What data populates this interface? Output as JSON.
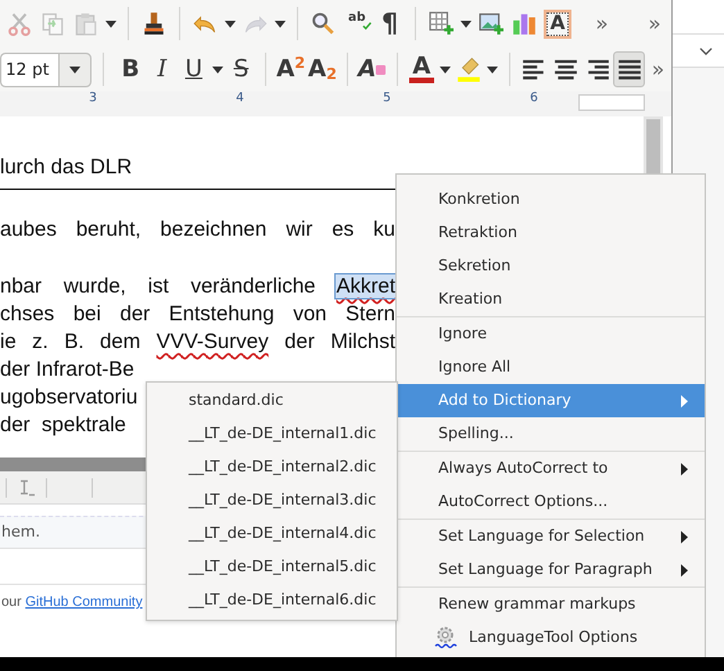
{
  "toolbar_1": [
    {
      "kind": "cut",
      "disabled": true
    },
    {
      "kind": "copy",
      "disabled": true
    },
    {
      "kind": "paste",
      "disabled": true,
      "dropdown": true
    },
    {
      "kind": "separator"
    },
    {
      "kind": "clone",
      "disabled": false
    },
    {
      "kind": "separator"
    },
    {
      "kind": "undo",
      "disabled": false,
      "dropdown": true
    },
    {
      "kind": "redo",
      "disabled": true,
      "dropdown": true
    },
    {
      "kind": "separator"
    },
    {
      "kind": "find",
      "disabled": false
    },
    {
      "kind": "spelling",
      "label": "ab",
      "disabled": false
    },
    {
      "kind": "formatting-marks",
      "label": "¶",
      "disabled": false
    },
    {
      "kind": "separator"
    },
    {
      "kind": "table",
      "disabled": false,
      "dropdown": true
    },
    {
      "kind": "image",
      "disabled": false
    },
    {
      "kind": "chart",
      "disabled": false
    },
    {
      "kind": "text-box",
      "label": "A",
      "disabled": false
    },
    {
      "kind": "spacer"
    },
    {
      "kind": "overflow",
      "label": "»",
      "disabled": false
    },
    {
      "kind": "overflow",
      "label": "»",
      "disabled": false
    }
  ],
  "font_size": {
    "value": "12 pt"
  },
  "toolbar_2": [
    {
      "kind": "bold",
      "label": "B",
      "selected": false
    },
    {
      "kind": "italic",
      "label": "I",
      "selected": false
    },
    {
      "kind": "underline",
      "label": "U",
      "selected": false,
      "dropdown": true
    },
    {
      "kind": "strikethrough",
      "label": "S",
      "selected": false
    },
    {
      "kind": "separator"
    },
    {
      "kind": "superscript",
      "label": "A$^{2}$",
      "selected": false
    },
    {
      "kind": "subscript",
      "label": "A$_{2}$",
      "selected": false
    },
    {
      "kind": "separator"
    },
    {
      "kind": "clear-formatting",
      "label": "A",
      "selected": false
    },
    {
      "kind": "separator"
    },
    {
      "kind": "font-color",
      "label": "A",
      "selected": false,
      "dropdown": true
    },
    {
      "kind": "highlight",
      "selected": false,
      "dropdown": true
    },
    {
      "kind": "separator"
    },
    {
      "kind": "align-left",
      "selected": false
    },
    {
      "kind": "align-center",
      "selected": false
    },
    {
      "kind": "align-right",
      "selected": false
    },
    {
      "kind": "justify",
      "selected": true
    },
    {
      "kind": "overflow",
      "label": "»",
      "selected": false
    }
  ],
  "ruler": {
    "labels": [
      "3",
      "4",
      "5",
      "6"
    ]
  },
  "document": {
    "heading": "lurch das DLR",
    "lines": [
      {
        "kind": "justified",
        "segments": [
          {
            "kind": "plain",
            "text": "aubes beruht, bezeichnen wir es ku"
          }
        ]
      },
      {
        "kind": "blank"
      },
      {
        "kind": "justified",
        "segments": [
          {
            "kind": "plain",
            "text": "nbar wurde, ist veränderliche "
          },
          {
            "kind": "selected-misspelled",
            "text": "Akkret"
          }
        ]
      },
      {
        "kind": "justified",
        "segments": [
          {
            "kind": "plain",
            "text": "chses bei der Entstehung von Stern"
          }
        ]
      },
      {
        "kind": "justified",
        "segments": [
          {
            "kind": "plain",
            "text": "ie z. B. dem "
          },
          {
            "kind": "misspelled",
            "text": "VVV-Survey"
          },
          {
            "kind": "plain",
            "text": " der Milchst"
          }
        ]
      },
      {
        "kind": "partial",
        "segments": [
          {
            "kind": "plain",
            "text": "der Infrarot-Be"
          }
        ]
      },
      {
        "kind": "partial",
        "segments": [
          {
            "kind": "plain",
            "text": "ugobservatoriu"
          }
        ]
      },
      {
        "kind": "partial",
        "segments": [
          {
            "kind": "plain",
            "text": "der  spektrale"
          }
        ]
      }
    ]
  },
  "background_page": {
    "notice": "hem.",
    "footer_text": "our ",
    "footer_link": "GitHub Community"
  },
  "context_menu": {
    "items": [
      {
        "kind": "item",
        "label": "Konkretion",
        "selected": false,
        "submenu": false
      },
      {
        "kind": "item",
        "label": "Retraktion",
        "selected": false,
        "submenu": false
      },
      {
        "kind": "item",
        "label": "Sekretion",
        "selected": false,
        "submenu": false
      },
      {
        "kind": "item",
        "label": "Kreation",
        "selected": false,
        "submenu": false
      },
      {
        "kind": "separator"
      },
      {
        "kind": "item",
        "label": "Ignore",
        "selected": false,
        "submenu": false
      },
      {
        "kind": "item",
        "label": "Ignore All",
        "selected": false,
        "submenu": false
      },
      {
        "kind": "item",
        "label": "Add to Dictionary",
        "selected": true,
        "submenu": true
      },
      {
        "kind": "item",
        "label": "Spelling...",
        "selected": false,
        "submenu": false
      },
      {
        "kind": "separator"
      },
      {
        "kind": "item",
        "label": "Always AutoCorrect to",
        "selected": false,
        "submenu": true
      },
      {
        "kind": "item",
        "label": "AutoCorrect Options...",
        "selected": false,
        "submenu": false
      },
      {
        "kind": "separator"
      },
      {
        "kind": "item",
        "label": "Set Language for Selection",
        "selected": false,
        "submenu": true
      },
      {
        "kind": "item",
        "label": "Set Language for Paragraph",
        "selected": false,
        "submenu": true
      },
      {
        "kind": "separator"
      },
      {
        "kind": "item",
        "label": "Renew grammar markups",
        "selected": false,
        "submenu": false
      },
      {
        "kind": "icon-item",
        "label": "LanguageTool Options",
        "selected": false,
        "submenu": false
      }
    ]
  },
  "submenu": {
    "items": [
      {
        "label": "standard.dic",
        "selected": false
      },
      {
        "label": "__LT_de-DE_internal1.dic",
        "selected": false
      },
      {
        "label": "__LT_de-DE_internal2.dic",
        "selected": false
      },
      {
        "label": "__LT_de-DE_internal3.dic",
        "selected": false
      },
      {
        "label": "__LT_de-DE_internal4.dic",
        "selected": false
      },
      {
        "label": "__LT_de-DE_internal5.dic",
        "selected": false
      },
      {
        "label": "__LT_de-DE_internal6.dic",
        "selected": false
      }
    ]
  }
}
